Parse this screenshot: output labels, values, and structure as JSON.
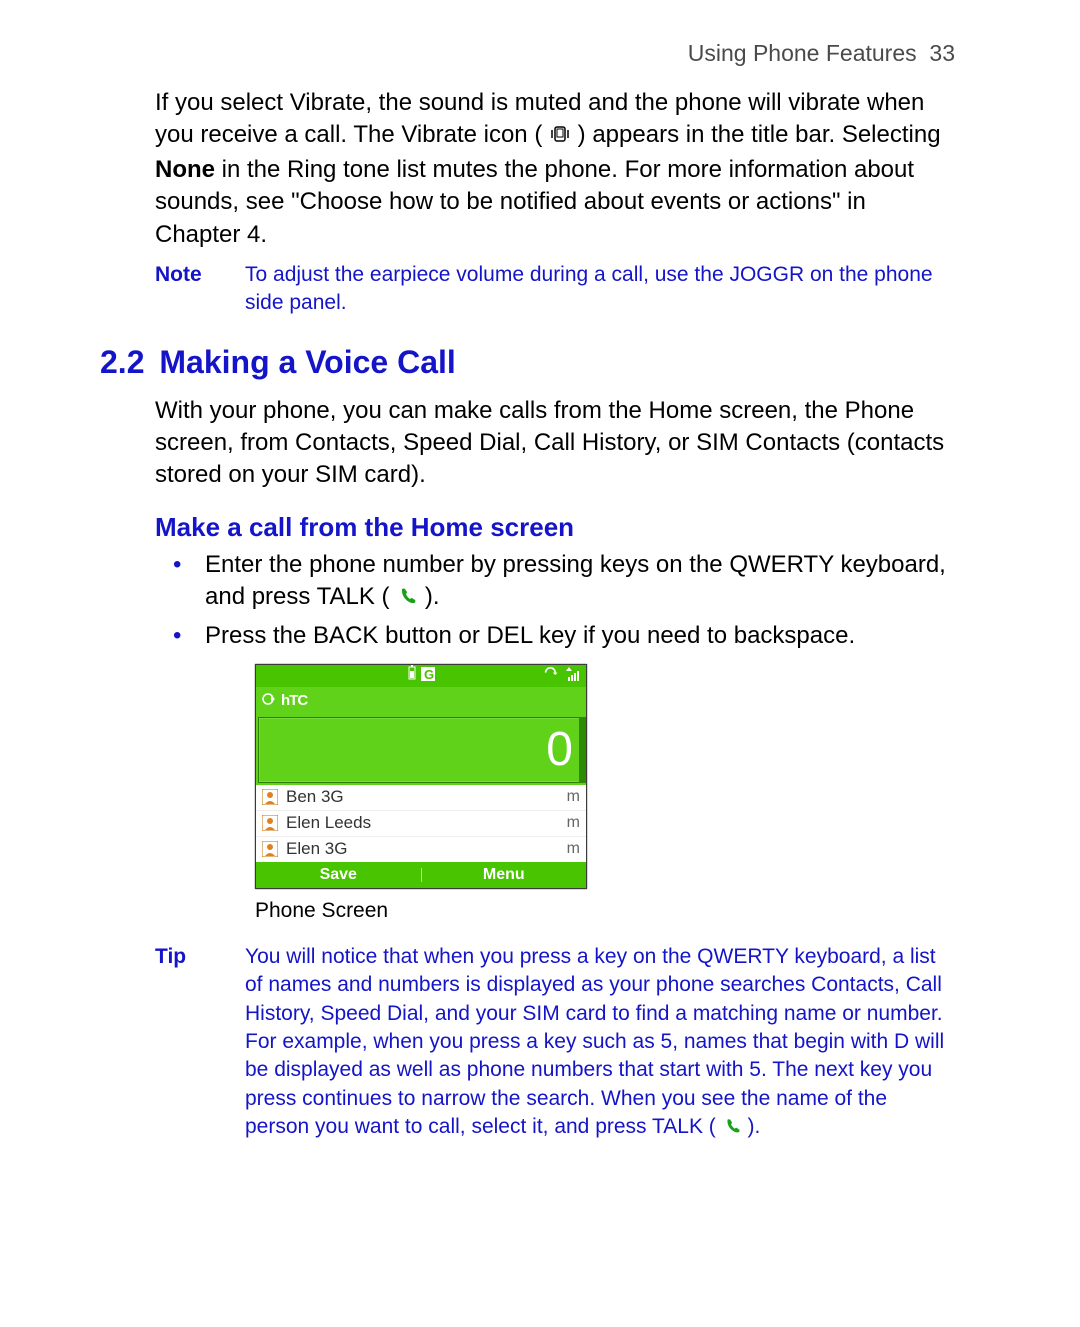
{
  "header": {
    "section": "Using Phone Features",
    "page": "33"
  },
  "intro": {
    "p1a": "If you select Vibrate, the sound is muted and the phone will vibrate when you receive a call. The Vibrate icon (",
    "p1b": ") appears in the title bar. Selecting ",
    "p1_bold": "None",
    "p1c": " in the Ring tone list mutes the phone. For more information about sounds, see \"Choose how to be notified about events or actions\" in Chapter 4."
  },
  "note": {
    "label": "Note",
    "body": "To adjust the earpiece volume during a call, use the JOGGR on the phone side panel."
  },
  "section": {
    "num": "2.2",
    "title": "Making a Voice Call"
  },
  "section_intro": "With your phone, you can make calls from the Home screen, the Phone screen, from Contacts, Speed Dial, Call History, or SIM Contacts (contacts stored on your SIM card).",
  "sub1": {
    "title": "Make a call from the Home screen"
  },
  "bullets": {
    "b1a": "Enter the phone number by pressing keys on the QWERTY keyboard, and press TALK (",
    "b1b": ").",
    "b2": "Press the BACK button or DEL key if you need to backspace."
  },
  "phone": {
    "brand": "hTC",
    "digit": "0",
    "contacts": [
      {
        "name": "Ben 3G",
        "key": "m"
      },
      {
        "name": "Elen  Leeds",
        "key": "m"
      },
      {
        "name": "Elen 3G",
        "key": "m"
      }
    ],
    "softkeys": {
      "left": "Save",
      "right": "Menu"
    }
  },
  "caption": "Phone Screen",
  "tip": {
    "label": "Tip",
    "body_a": "You will notice that when you press a key on the QWERTY keyboard, a list of names and numbers is displayed as your phone searches Contacts, Call History, Speed Dial, and your SIM card to find a matching name or number. For example, when you press a key such as 5, names that begin with D will be displayed as well as phone numbers that start with 5. The next key you press continues to narrow the search. When you see the name of the person you want to call, select it, and press TALK (",
    "body_b": ")."
  }
}
